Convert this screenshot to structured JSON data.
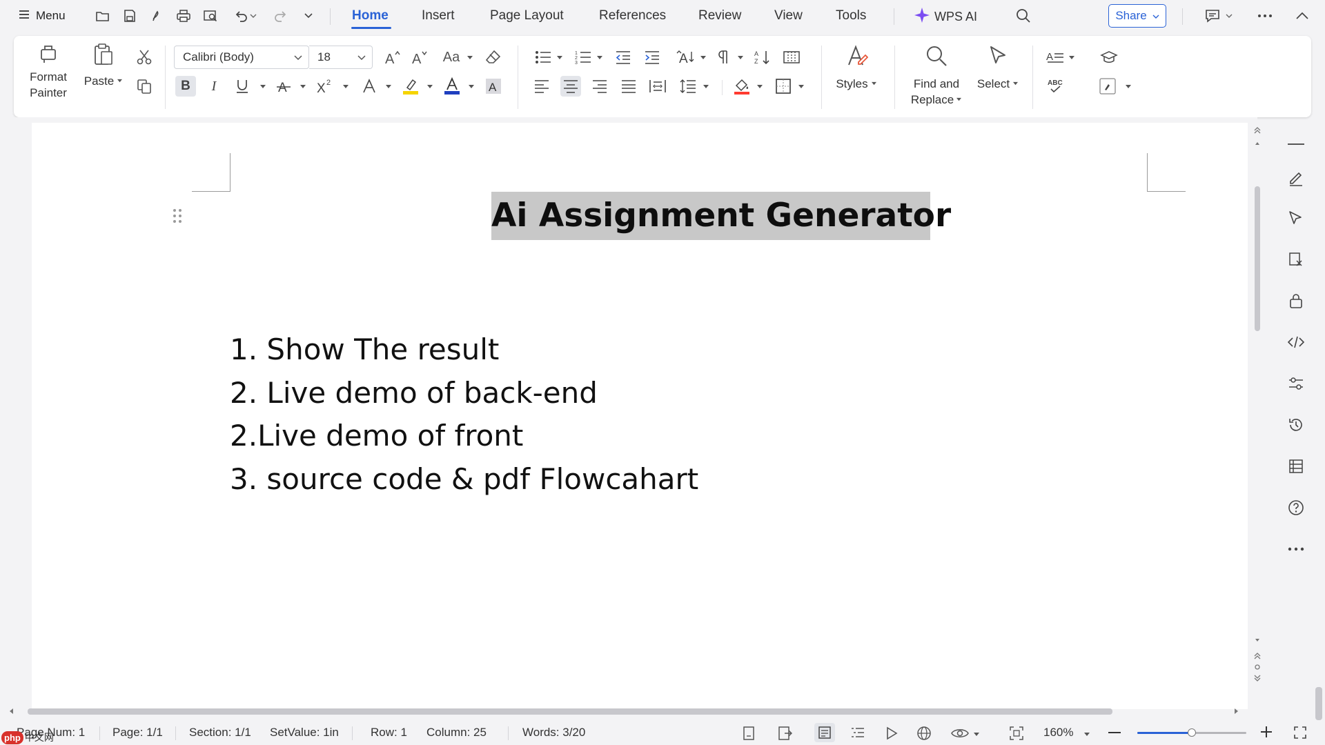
{
  "app": {
    "menu_label": "Menu",
    "tabs": [
      {
        "label": "Home",
        "active": true
      },
      {
        "label": "Insert"
      },
      {
        "label": "Page Layout"
      },
      {
        "label": "References"
      },
      {
        "label": "Review"
      },
      {
        "label": "View"
      },
      {
        "label": "Tools"
      }
    ],
    "wps_ai_label": "WPS AI",
    "share_label": "Share",
    "accent_color": "#2a62d6"
  },
  "ribbon": {
    "format_painter": {
      "line1": "Format",
      "line2": "Painter"
    },
    "paste_label": "Paste",
    "font_name": "Calibri (Body)",
    "font_size": "18",
    "styles_label": "Styles",
    "find_replace": {
      "line1": "Find and",
      "line2": "Replace"
    },
    "select_label": "Select",
    "abc_label": "ABC",
    "change_case_label": "Aa",
    "font_color": "#1f3fbf",
    "highlight_color": "#f5d400"
  },
  "document": {
    "title": "Ai Assignment Generator",
    "items": [
      "1. Show The result",
      "2. Live demo of back-end",
      "2.Live demo of front",
      "3. source code & pdf Flowcahart"
    ]
  },
  "status": {
    "page_num": "Page Num: 1",
    "page": "Page: 1/1",
    "section": "Section: 1/1",
    "set_value": "SetValue: 1in",
    "row": "Row: 1",
    "column": "Column: 25",
    "words": "Words: 3/20",
    "zoom": "160%",
    "zoom_level": 0.5
  },
  "watermark": {
    "logo": "php",
    "text": "中文网"
  }
}
